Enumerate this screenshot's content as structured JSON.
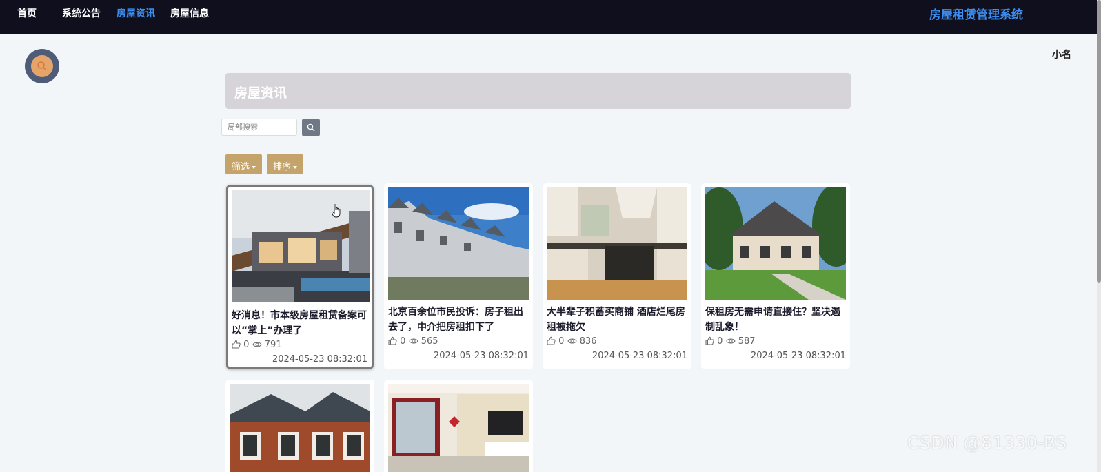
{
  "nav": {
    "items": [
      {
        "label": "首页"
      },
      {
        "label": "系统公告"
      },
      {
        "label": "房屋资讯"
      },
      {
        "label": "房屋信息"
      }
    ],
    "active_index": 2,
    "brand": "房屋租赁管理系统"
  },
  "user": {
    "name": "小名"
  },
  "page": {
    "title": "房屋资讯"
  },
  "search": {
    "placeholder": "局部搜索",
    "value": ""
  },
  "filters": {
    "filter_label": "筛选",
    "sort_label": "排序"
  },
  "cards": [
    {
      "title": "好消息！市本级房屋租赁备案可以“掌上”办理了",
      "likes": "0",
      "views": "791",
      "date": "2024-05-23 08:32:01",
      "image": "modern-villa"
    },
    {
      "title": "北京百余位市民投诉：房子租出去了，中介把房租扣下了",
      "likes": "0",
      "views": "565",
      "date": "2024-05-23 08:32:01",
      "image": "townhouses"
    },
    {
      "title": "大半辈子积蓄买商铺 酒店烂尾房租被拖欠",
      "likes": "0",
      "views": "836",
      "date": "2024-05-23 08:32:01",
      "image": "kitchen"
    },
    {
      "title": "保租房无需申请直接住？坚决遏制乱象！",
      "likes": "0",
      "views": "587",
      "date": "2024-05-23 08:32:01",
      "image": "suburban-house"
    },
    {
      "title": "",
      "likes": "",
      "views": "",
      "date": "",
      "image": "brick-cottage"
    },
    {
      "title": "",
      "likes": "",
      "views": "",
      "date": "",
      "image": "living-room"
    }
  ],
  "watermark": "CSDN @81330-BS",
  "colors": {
    "topbar": "#0f0f1e",
    "accent": "#3b8ef0",
    "filter_button": "#c4a46a",
    "avatar_ring": "#4e5c78",
    "avatar_fill": "#e4a46a"
  },
  "icons": {
    "search": "search-icon",
    "like": "thumbs-up-icon",
    "views": "eye-icon",
    "cursor": "hand-cursor-icon"
  }
}
